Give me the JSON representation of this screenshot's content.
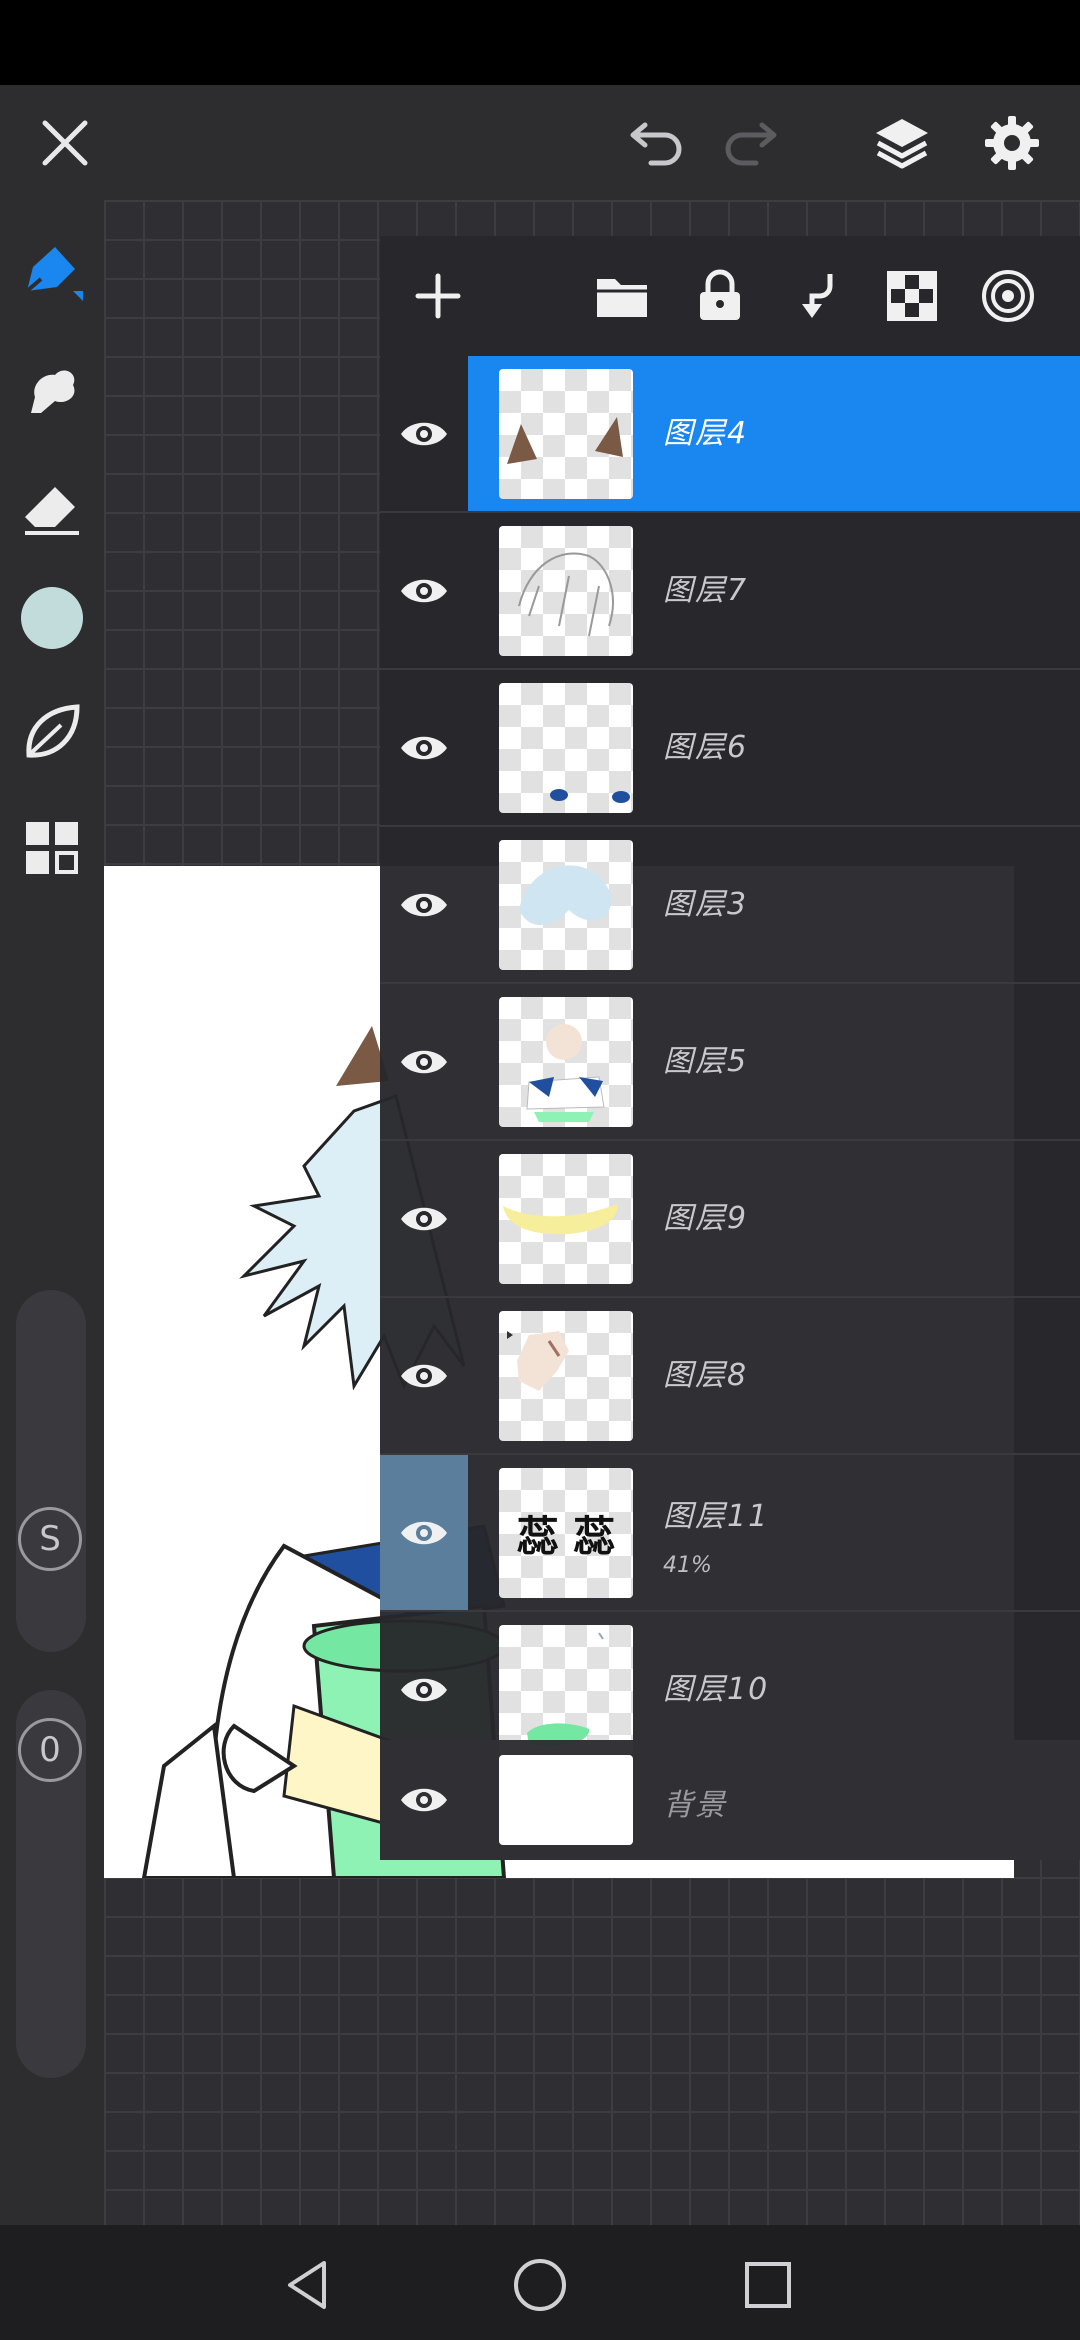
{
  "colors": {
    "accent": "#1a86f0",
    "current_color": "#c2dcdc",
    "highlight_eye": "#5a7e9c"
  },
  "top_bar": {
    "icons": [
      "close-icon",
      "undo-icon",
      "redo-icon",
      "layers-icon",
      "settings-icon"
    ]
  },
  "left_toolbar": {
    "tools": [
      "brush-tool",
      "smudge-tool",
      "eraser-tool",
      "color-swatch",
      "leaf-tool",
      "gallery-tool"
    ],
    "size_slider_label": "S",
    "opacity_slider_label": "0"
  },
  "layers_panel": {
    "header_icons": [
      "add-icon",
      "folder-icon",
      "lock-icon",
      "merge-down-icon",
      "checker-icon",
      "target-icon"
    ],
    "layers": [
      {
        "name": "图层4",
        "selected": true,
        "opacity": ""
      },
      {
        "name": "图层7",
        "selected": false,
        "opacity": ""
      },
      {
        "name": "图层6",
        "selected": false,
        "opacity": ""
      },
      {
        "name": "图层3",
        "selected": false,
        "opacity": ""
      },
      {
        "name": "图层5",
        "selected": false,
        "opacity": ""
      },
      {
        "name": "图层9",
        "selected": false,
        "opacity": ""
      },
      {
        "name": "图层8",
        "selected": false,
        "opacity": ""
      },
      {
        "name": "图层11",
        "selected": false,
        "opacity": "41%",
        "thumb_text": "蕊 蕊"
      },
      {
        "name": "图层10",
        "selected": false,
        "opacity": ""
      }
    ],
    "background_layer": {
      "name": "背景"
    }
  },
  "nav_bar": {
    "icons": [
      "back-icon",
      "home-icon",
      "recents-icon"
    ]
  }
}
